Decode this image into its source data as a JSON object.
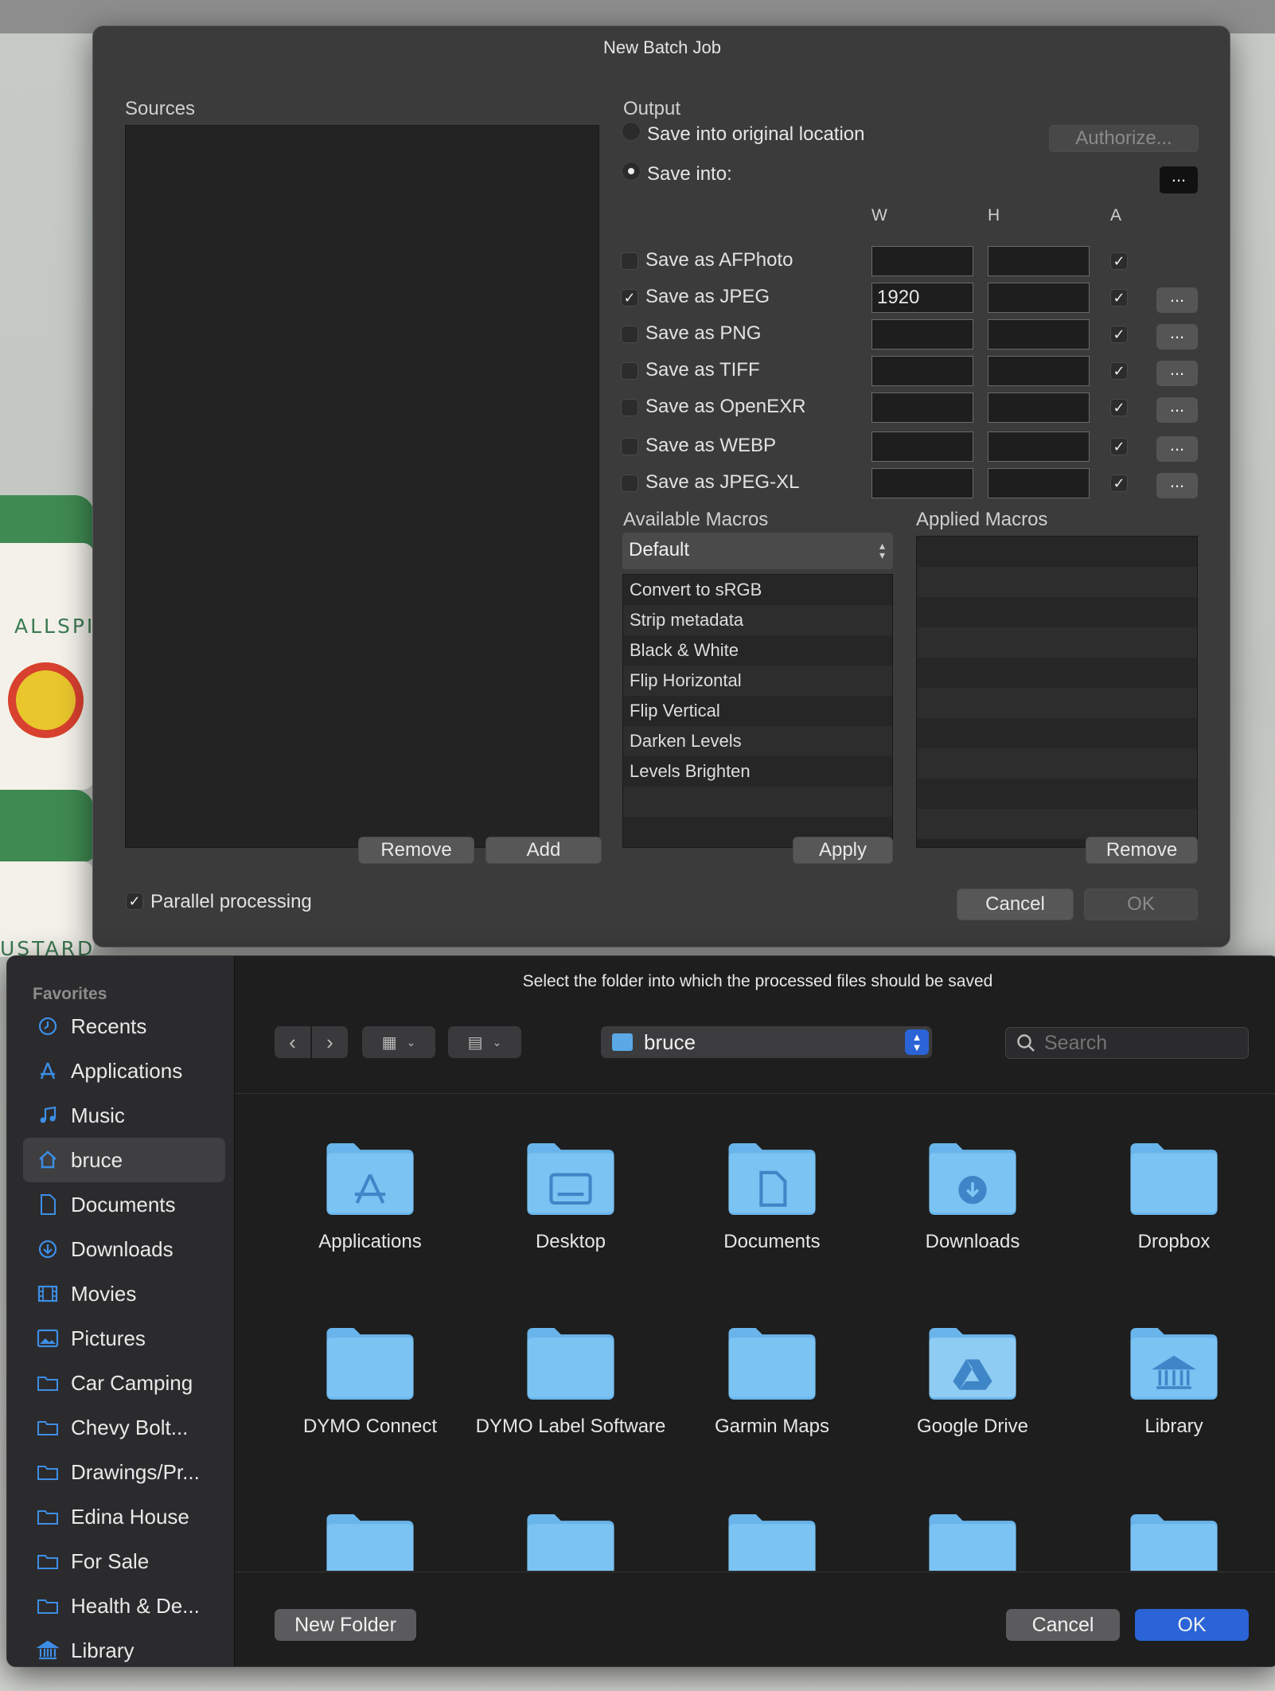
{
  "batch": {
    "title": "New Batch Job",
    "sources_label": "Sources",
    "output_label": "Output",
    "save_original": "Save into original location",
    "authorize": "Authorize...",
    "save_into": "Save into:",
    "browse": "...",
    "col_w": "W",
    "col_h": "H",
    "col_a": "A",
    "formats": [
      {
        "label": "Save as AFPhoto",
        "checked": false,
        "w": "",
        "h": "",
        "a": true,
        "has_options": false
      },
      {
        "label": "Save as JPEG",
        "checked": true,
        "w": "1920",
        "h": "",
        "a": true,
        "has_options": true
      },
      {
        "label": "Save as PNG",
        "checked": false,
        "w": "",
        "h": "",
        "a": true,
        "has_options": true
      },
      {
        "label": "Save as TIFF",
        "checked": false,
        "w": "",
        "h": "",
        "a": true,
        "has_options": true
      },
      {
        "label": "Save as OpenEXR",
        "checked": false,
        "w": "",
        "h": "",
        "a": true,
        "has_options": true
      },
      {
        "label": "Save as WEBP",
        "checked": false,
        "w": "",
        "h": "",
        "a": true,
        "has_options": true
      },
      {
        "label": "Save as JPEG-XL",
        "checked": false,
        "w": "",
        "h": "",
        "a": true,
        "has_options": true
      }
    ],
    "options_label": "...",
    "available_macros_label": "Available Macros",
    "macro_category": "Default",
    "macros": [
      "Convert to sRGB",
      "Strip metadata",
      "Black & White",
      "Flip Horizontal",
      "Flip Vertical",
      "Darken Levels",
      "Levels Brighten"
    ],
    "applied_macros_label": "Applied Macros",
    "remove_source": "Remove",
    "add_source": "Add",
    "apply": "Apply",
    "remove_macro": "Remove",
    "parallel": "Parallel processing",
    "parallel_checked": "✓",
    "cancel": "Cancel",
    "ok": "OK"
  },
  "background": {
    "jar1_label": "ALLSPIC",
    "jar2_label": "USTARD"
  },
  "save_panel": {
    "message": "Select the folder into which the processed files should be saved",
    "location": "bruce",
    "search_placeholder": "Search",
    "favorites_label": "Favorites",
    "sidebar": [
      {
        "label": "Recents",
        "icon": "clock-icon"
      },
      {
        "label": "Applications",
        "icon": "applications-icon"
      },
      {
        "label": "Music",
        "icon": "music-note-icon"
      },
      {
        "label": "bruce",
        "icon": "home-icon",
        "selected": true
      },
      {
        "label": "Documents",
        "icon": "document-icon"
      },
      {
        "label": "Downloads",
        "icon": "download-icon"
      },
      {
        "label": "Movies",
        "icon": "film-icon"
      },
      {
        "label": "Pictures",
        "icon": "photo-icon"
      },
      {
        "label": "Car Camping",
        "icon": "folder-icon"
      },
      {
        "label": "Chevy Bolt...",
        "icon": "folder-icon"
      },
      {
        "label": "Drawings/Pr...",
        "icon": "folder-icon"
      },
      {
        "label": "Edina House",
        "icon": "folder-icon"
      },
      {
        "label": "For Sale",
        "icon": "folder-icon"
      },
      {
        "label": "Health & De...",
        "icon": "folder-icon"
      },
      {
        "label": "Library",
        "icon": "library-icon"
      }
    ],
    "folders_row1": [
      {
        "label": "Applications",
        "glyph": "applications-icon"
      },
      {
        "label": "Desktop",
        "glyph": "desktop-icon"
      },
      {
        "label": "Documents",
        "glyph": "document-icon"
      },
      {
        "label": "Downloads",
        "glyph": "download-icon"
      },
      {
        "label": "Dropbox",
        "glyph": ""
      }
    ],
    "folders_row2": [
      {
        "label": "DYMO Connect",
        "glyph": ""
      },
      {
        "label": "DYMO Label Software",
        "glyph": ""
      },
      {
        "label": "Garmin Maps",
        "glyph": ""
      },
      {
        "label": "Google Drive",
        "glyph": "google-drive-icon"
      },
      {
        "label": "Library",
        "glyph": "library-icon"
      }
    ],
    "new_folder": "New Folder",
    "cancel": "Cancel",
    "ok": "OK"
  }
}
